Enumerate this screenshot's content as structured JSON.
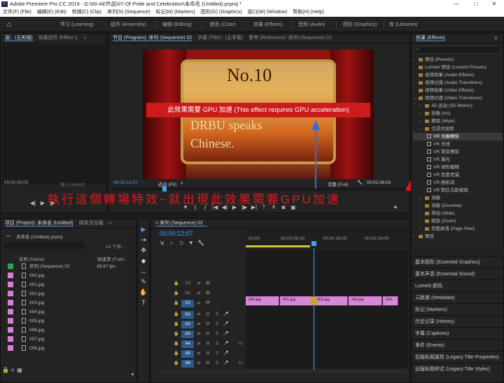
{
  "window": {
    "title": "Adobe Premiere Pro CC 2019 - G:\\00-AE作品\\07-Of Pride and Celebration\\未命名 (Untitled).prproj *",
    "icon_label": "Pr",
    "minimize": "—",
    "maximize": "□",
    "close": "✕"
  },
  "menu": [
    "文件(F) (File)",
    "编辑(E) (Edit)",
    "剪辑(C) (Clip)",
    "序列(S) (Sequence)",
    "标记(M) (Markers)",
    "图形(G) (Graphics)",
    "窗口(W) (Window)",
    "帮助(H) (Help)"
  ],
  "workspaces": [
    "学习 (Learning)",
    "组件 (Assembly)",
    "编辑 (Editing)",
    "颜色 (Color)",
    "效果 (Effects)",
    "音频 (Audio)",
    "图形 (Graphics)",
    "库 (Libraries)"
  ],
  "source_panel": {
    "tabs": [
      "源：(无剪辑)",
      "效果控件 (Effect C",
      "»"
    ],
    "timecode": "00;00;00;00",
    "insert_hint": "插入 (Insert)"
  },
  "program_panel": {
    "tabs": [
      "节目 (Program): 序列 (Sequence) 02",
      "字幕 (Title) : (无字幕)",
      "参考 (Reference): 序列 (Sequence) 02"
    ],
    "video_title": "No.10",
    "video_text_line1": "DRBU speaks",
    "video_text_line2": "Chinese.",
    "gpu_warning": "此效果需要 GPU 加速 (This effect requires GPU acceleration)",
    "timecode": "00;00;12;07",
    "fit": "适合 (Fit)",
    "quality": "完整 (Full)",
    "duration": "00;01;06;02"
  },
  "annotation": {
    "text": "執行這個轉場特效~就出現此效果需要GPU加速",
    "color": "#e0191f"
  },
  "effects_panel": {
    "title": "效果 (Effects)",
    "more": "≡",
    "search_placeholder": "",
    "tree": [
      {
        "label": "预设 (Presets)",
        "type": "folder",
        "depth": 0
      },
      {
        "label": "Lumetri 预设 (Lumetri Presets)",
        "type": "folder",
        "depth": 0
      },
      {
        "label": "音频效果 (Audio Effects)",
        "type": "folder",
        "depth": 0
      },
      {
        "label": "音频过渡 (Audio Transitions)",
        "type": "folder",
        "depth": 0
      },
      {
        "label": "视频效果 (Video Effects)",
        "type": "folder",
        "depth": 0
      },
      {
        "label": "视频过渡 (Video Transitions)",
        "type": "folder-open",
        "depth": 0
      },
      {
        "label": "3D 运动 (3D Motion)",
        "type": "folder",
        "depth": 1
      },
      {
        "label": "划像 (Iris)",
        "type": "folder",
        "depth": 1
      },
      {
        "label": "擦除 (Wipe)",
        "type": "folder",
        "depth": 1
      },
      {
        "label": "沉浸式视频",
        "type": "folder-open",
        "depth": 1
      },
      {
        "label": "VR 光圈擦除",
        "type": "vr",
        "depth": 2,
        "selected": true
      },
      {
        "label": "VR 光线",
        "type": "vr",
        "depth": 2
      },
      {
        "label": "VR 渐变擦除",
        "type": "vr",
        "depth": 2
      },
      {
        "label": "VR 漏光",
        "type": "vr",
        "depth": 2
      },
      {
        "label": "VR 球形模糊",
        "type": "vr",
        "depth": 2
      },
      {
        "label": "VR 色度泄漏",
        "type": "vr",
        "depth": 2
      },
      {
        "label": "VR 随机块",
        "type": "vr",
        "depth": 2
      },
      {
        "label": "VR 默比乌斯缩放",
        "type": "vr",
        "depth": 2
      },
      {
        "label": "溶解",
        "type": "folder",
        "depth": 1
      },
      {
        "label": "溶解 (Dissolve)",
        "type": "folder",
        "depth": 1
      },
      {
        "label": "滑动 (Slide)",
        "type": "folder",
        "depth": 1
      },
      {
        "label": "缩放 (Zoom)",
        "type": "folder",
        "depth": 1
      },
      {
        "label": "页面剥落 (Page Peel)",
        "type": "folder",
        "depth": 1
      },
      {
        "label": "预设",
        "type": "folder",
        "depth": 0
      }
    ],
    "accordions": [
      "基本图形 (Essential Graphics)",
      "基本声音 (Essential Sound)",
      "Lumetri 颜色",
      "元数据 (Metadata)",
      "标记 (Markers)",
      "历史记录 (History)",
      "字幕 (Captions)",
      "事件 (Events)",
      "旧版标题属性 (Legacy Title Properties)",
      "旧版标题样式 (Legacy Title Styles)"
    ]
  },
  "project_panel": {
    "tabs": [
      "项目 (Project): 未命名 (Untitled)",
      "媒体浏览器",
      "»"
    ],
    "file": "未命名 (Untitled).prproj",
    "items_count": "13 个项...",
    "col_name": "名称 (Name)",
    "col_fps": "帧速率 (Fram",
    "items": [
      {
        "name": "序列 (Sequence) 02",
        "fps": "29.97 fps",
        "color": "#2fa24a",
        "kind": "seq"
      },
      {
        "name": "000.jpg",
        "fps": "",
        "color": "#d680d6",
        "kind": "file"
      },
      {
        "name": "001.jpg",
        "fps": "",
        "color": "#d680d6",
        "kind": "file"
      },
      {
        "name": "002.jpg",
        "fps": "",
        "color": "#d680d6",
        "kind": "file"
      },
      {
        "name": "003.jpg",
        "fps": "",
        "color": "#d680d6",
        "kind": "file"
      },
      {
        "name": "004.jpg",
        "fps": "",
        "color": "#d680d6",
        "kind": "file"
      },
      {
        "name": "005.jpg",
        "fps": "",
        "color": "#d680d6",
        "kind": "file"
      },
      {
        "name": "006.jpg",
        "fps": "",
        "color": "#d680d6",
        "kind": "file"
      },
      {
        "name": "007.jpg",
        "fps": "",
        "color": "#d680d6",
        "kind": "file"
      },
      {
        "name": "008.jpg",
        "fps": "",
        "color": "#d680d6",
        "kind": "file"
      }
    ]
  },
  "tools": [
    "▶",
    "⇥",
    "✥",
    "◆",
    "↔",
    "✎",
    "✋",
    "T"
  ],
  "timeline": {
    "tab": "序列 (Sequence) 02",
    "timecode": "00;00;12;07",
    "ruler": [
      ":00;00",
      "00;00;08;00",
      "00;00;16;00",
      "00;00;24;00"
    ],
    "video_tracks": [
      "V3",
      "V2",
      "V1"
    ],
    "audio_tracks": [
      "A1",
      "A2",
      "A3",
      "A4",
      "A5",
      "A6"
    ],
    "audio_levels": [
      "",
      "",
      "",
      "51",
      "",
      "51"
    ],
    "clips": [
      "000.jpg",
      "001.jpg",
      "002.jpg",
      "003.jpg",
      "004"
    ],
    "toggles": {
      "lock": "🔒",
      "eye": "👁",
      "mute": "M",
      "solo": "S",
      "mic": "🎤"
    }
  }
}
